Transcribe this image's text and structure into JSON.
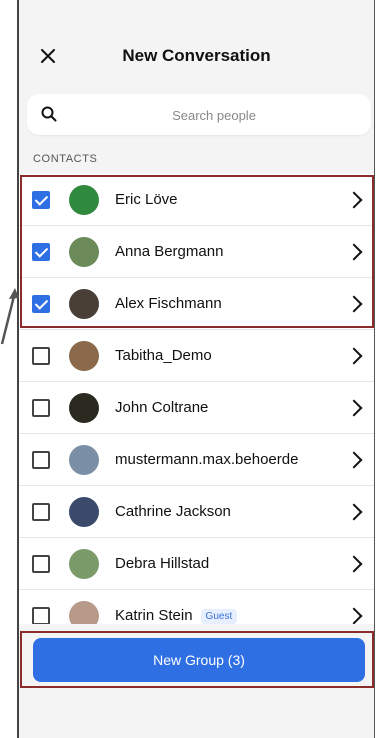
{
  "header": {
    "title": "New Conversation",
    "close_icon": "close-icon"
  },
  "search": {
    "placeholder": "Search people"
  },
  "section_label": "CONTACTS",
  "contacts": [
    {
      "name": "Eric Löve",
      "checked": true,
      "avatar_color": "#2f8a3e"
    },
    {
      "name": "Anna Bergmann",
      "checked": true,
      "avatar_color": "#6d8a5a"
    },
    {
      "name": "Alex Fischmann",
      "checked": true,
      "avatar_color": "#4a3f36"
    },
    {
      "name": "Tabitha_Demo",
      "checked": false,
      "avatar_color": "#8a6a4a"
    },
    {
      "name": "John Coltrane",
      "checked": false,
      "avatar_color": "#2b2a20"
    },
    {
      "name": "mustermann.max.behoerde",
      "checked": false,
      "avatar_color": "#7a8ea6"
    },
    {
      "name": "Cathrine Jackson",
      "checked": false,
      "avatar_color": "#3a4a6a"
    },
    {
      "name": "Debra Hillstad",
      "checked": false,
      "avatar_color": "#7a9a6a"
    },
    {
      "name": "Katrin Stein",
      "checked": false,
      "avatar_color": "#b89a8a",
      "badge": "Guest"
    }
  ],
  "footer": {
    "button_label": "New Group (3)"
  },
  "colors": {
    "accent": "#2f6fe4",
    "highlight": "#8b2c2c"
  }
}
